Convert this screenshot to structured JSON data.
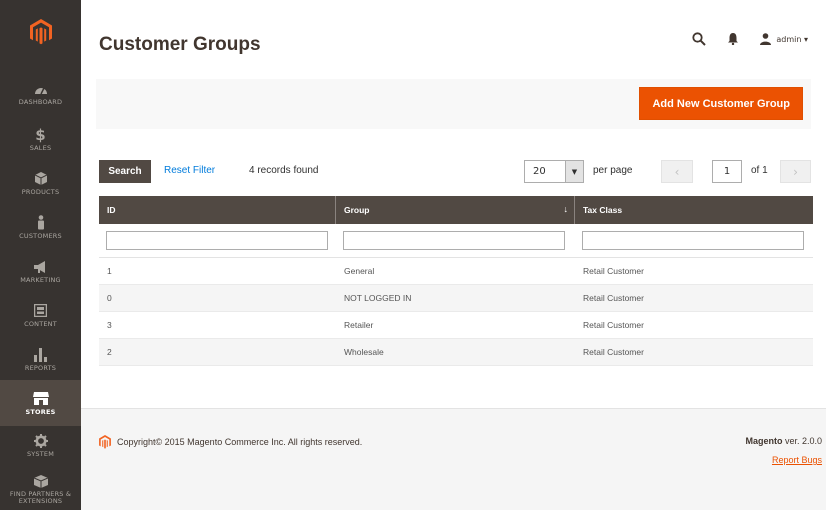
{
  "header": {
    "title": "Customer Groups",
    "user_label": "admin ▾"
  },
  "sidebar": {
    "items": [
      {
        "label": "DASHBOARD",
        "icon": "dashboard-icon"
      },
      {
        "label": "SALES",
        "icon": "dollar-icon"
      },
      {
        "label": "PRODUCTS",
        "icon": "cube-icon"
      },
      {
        "label": "CUSTOMERS",
        "icon": "person-icon"
      },
      {
        "label": "MARKETING",
        "icon": "megaphone-icon"
      },
      {
        "label": "CONTENT",
        "icon": "layout-icon"
      },
      {
        "label": "REPORTS",
        "icon": "bar-chart-icon"
      },
      {
        "label": "STORES",
        "icon": "storefront-icon",
        "active": true
      },
      {
        "label": "SYSTEM",
        "icon": "gear-icon"
      },
      {
        "label": "FIND PARTNERS & EXTENSIONS",
        "icon": "cube-icon"
      }
    ]
  },
  "actions": {
    "add_new_label": "Add New Customer Group"
  },
  "toolbar": {
    "search_label": "Search",
    "reset_filter_label": "Reset Filter",
    "records_found": "4 records found",
    "per_page_value": "20",
    "per_page_label": "per page",
    "current_page": "1",
    "of_pages": "of 1"
  },
  "grid": {
    "columns": [
      "ID",
      "Group",
      "Tax Class"
    ],
    "rows": [
      {
        "id": "1",
        "group": "General",
        "tax_class": "Retail Customer"
      },
      {
        "id": "0",
        "group": "NOT LOGGED IN",
        "tax_class": "Retail Customer"
      },
      {
        "id": "3",
        "group": "Retailer",
        "tax_class": "Retail Customer"
      },
      {
        "id": "2",
        "group": "Wholesale",
        "tax_class": "Retail Customer"
      }
    ]
  },
  "footer": {
    "copyright": "Copyright© 2015 Magento Commerce Inc. All rights reserved.",
    "brand": "Magento",
    "version": " ver. 2.0.0",
    "report_bugs": "Report Bugs"
  },
  "colors": {
    "accent": "#eb5202",
    "sidebar": "#373330",
    "grid_header": "#514943",
    "link": "#007bdb"
  }
}
